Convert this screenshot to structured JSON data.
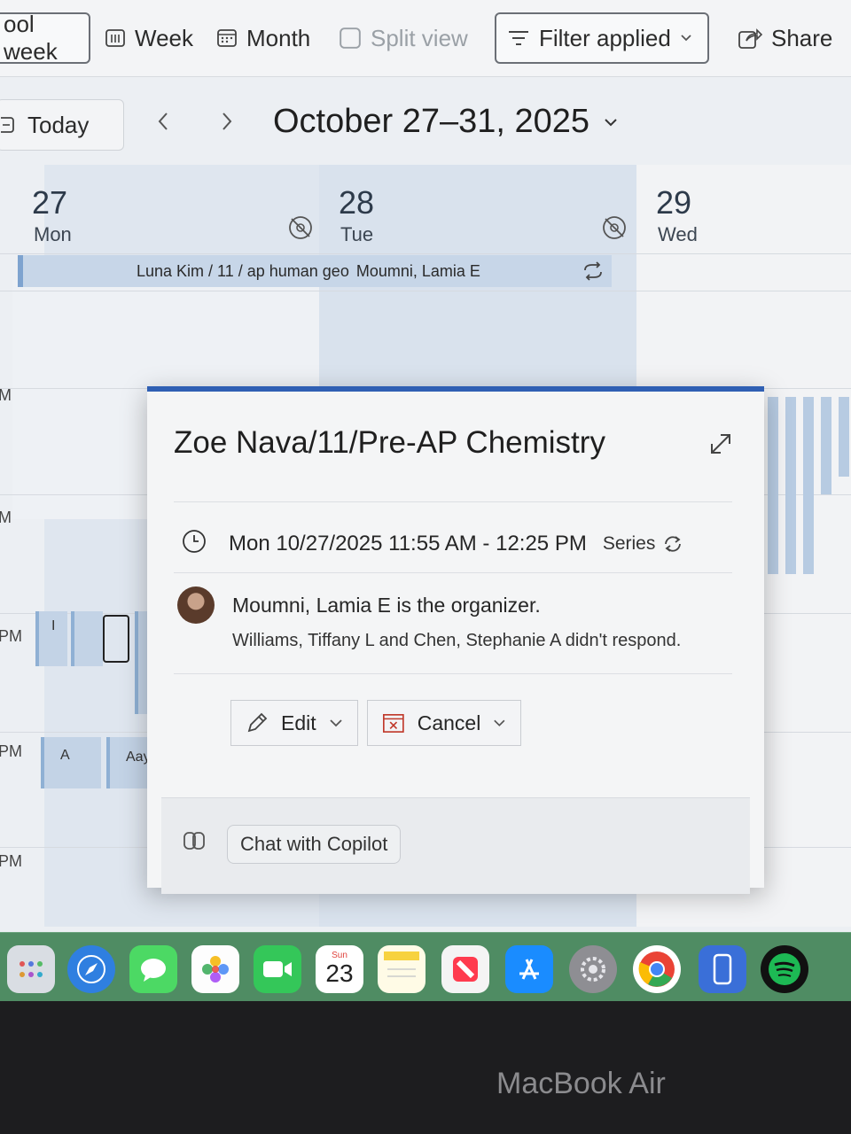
{
  "toolbar": {
    "school_week_label": "ool week",
    "week_label": "Week",
    "month_label": "Month",
    "split_view_label": "Split view",
    "filter_label": "Filter applied",
    "share_label": "Share"
  },
  "nav": {
    "today_label": "Today",
    "date_range": "October 27–31, 2025"
  },
  "days": [
    {
      "num": "27",
      "name": "Mon"
    },
    {
      "num": "28",
      "name": "Tue"
    },
    {
      "num": "29",
      "name": "Wed"
    }
  ],
  "allday_event": {
    "title": "Luna Kim / 11 / ap human geo",
    "organizer": "Moumni, Lamia E"
  },
  "time_labels": [
    "M",
    "M",
    "PM",
    "PM",
    "PM"
  ],
  "mini_events": {
    "e1": "I",
    "e2": "A",
    "e3": "Aayu"
  },
  "popup": {
    "title": "Zoe Nava/11/Pre-AP Chemistry",
    "when": "Mon 10/27/2025 11:55 AM - 12:25 PM",
    "series_label": "Series",
    "organizer_text": "Moumni, Lamia E is the organizer.",
    "no_response_text": "Williams, Tiffany L and Chen, Stephanie A didn't respond.",
    "edit_label": "Edit",
    "cancel_label": "Cancel",
    "copilot_label": "Chat with Copilot"
  },
  "dock": {
    "calendar_day_name": "Sun",
    "calendar_day_number": "23"
  },
  "device_label": "MacBook Air",
  "colors": {
    "accent": "#2f5fb3",
    "event_fill": "#c7d6e8",
    "event_border": "#7ea3cf"
  }
}
